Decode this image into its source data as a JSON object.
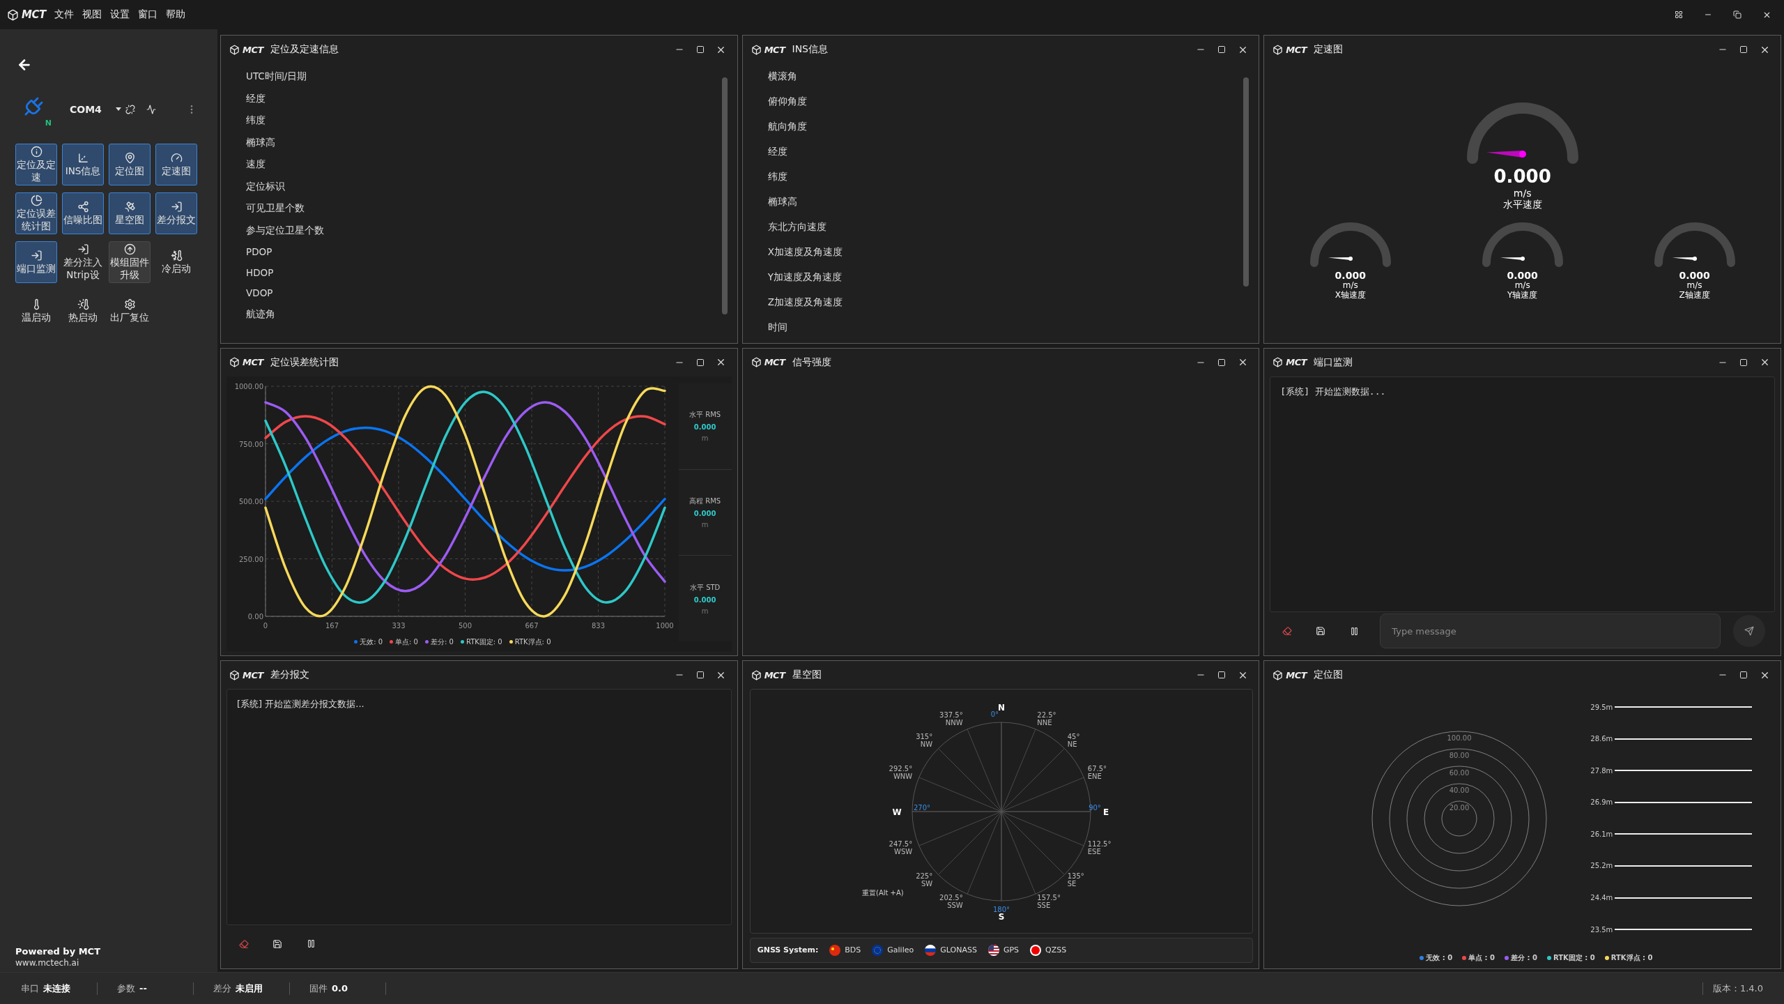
{
  "menu_bar": {
    "logo": "MCT",
    "menus": [
      "文件",
      "视图",
      "设置",
      "窗口",
      "帮助"
    ]
  },
  "sidebar": {
    "device": {
      "port": "COM4",
      "badge": "N"
    },
    "tools": [
      {
        "label": "定位及定速",
        "selected": true,
        "hovered": false
      },
      {
        "label": "INS信息",
        "selected": true,
        "hovered": false
      },
      {
        "label": "定位图",
        "selected": true,
        "hovered": false
      },
      {
        "label": "定速图",
        "selected": true,
        "hovered": false
      },
      {
        "label": "定位误差统计图",
        "selected": true,
        "hovered": false
      },
      {
        "label": "信噪比图",
        "selected": true,
        "hovered": false
      },
      {
        "label": "星空图",
        "selected": true,
        "hovered": false
      },
      {
        "label": "差分报文",
        "selected": true,
        "hovered": false
      },
      {
        "label": "端口监测",
        "selected": true,
        "hovered": false
      },
      {
        "label": "差分注入Ntrip设",
        "selected": false,
        "hovered": false
      },
      {
        "label": "模组固件升级",
        "selected": false,
        "hovered": true
      },
      {
        "label": "冷启动",
        "selected": false,
        "hovered": false
      },
      {
        "label": "温启动",
        "selected": false,
        "hovered": false
      },
      {
        "label": "热启动",
        "selected": false,
        "hovered": false
      },
      {
        "label": "出厂复位",
        "selected": false,
        "hovered": false
      }
    ],
    "footer": {
      "powered": "Powered by MCT",
      "url": "www.mctech.ai"
    }
  },
  "panels": [
    {
      "kind": "fields",
      "brand": "MCT",
      "title": "定位及定速信息",
      "fields": [
        "UTC时间/日期",
        "经度",
        "纬度",
        "椭球高",
        "速度",
        "定位标识",
        "可见卫星个数",
        "参与定位卫星个数",
        "PDOP",
        "HDOP",
        "VDOP",
        "航迹角"
      ]
    },
    {
      "kind": "fields",
      "brand": "MCT",
      "title": "INS信息",
      "fields": [
        "横滚角",
        "俯仰角度",
        "航向角度",
        "经度",
        "纬度",
        "椭球高",
        "东北方向速度",
        "X加速度及角速度",
        "Y加速度及角速度",
        "Z加速度及角速度",
        "时间"
      ]
    },
    {
      "kind": "gauges",
      "brand": "MCT",
      "title": "定速图",
      "gauges": [
        {
          "value": "0.000",
          "unit": "m/s",
          "label": "水平速度"
        },
        {
          "value": "0.000",
          "unit": "m/s",
          "label": "X轴速度"
        },
        {
          "value": "0.000",
          "unit": "m/s",
          "label": "Y轴速度"
        },
        {
          "value": "0.000",
          "unit": "m/s",
          "label": "Z轴速度"
        }
      ]
    },
    {
      "kind": "error_chart",
      "brand": "MCT",
      "title": "定位误差统计图",
      "chart_data": {
        "type": "line",
        "grid": true,
        "legend": "bottom",
        "x": [
          0,
          50,
          100,
          150,
          200,
          250,
          300,
          350,
          400,
          450,
          500,
          550,
          600,
          650,
          700,
          750,
          800,
          850,
          900,
          950,
          1000
        ],
        "xlim": [
          0,
          1000
        ],
        "ylim": [
          0,
          1000
        ],
        "xticks": [
          0,
          {
            "value": 166.7,
            "label": "167"
          },
          {
            "value": 333.3,
            "label": "333"
          },
          500,
          {
            "value": 666.7,
            "label": "667"
          },
          {
            "value": 833.3,
            "label": "833"
          },
          1000
        ],
        "yticks": [
          {
            "value": 0,
            "label": "0.00"
          },
          {
            "value": 250,
            "label": "250.00"
          },
          {
            "value": 500,
            "label": "500.00"
          },
          {
            "value": 750,
            "label": "750.00"
          },
          {
            "value": 1000,
            "label": "1000.00"
          }
        ],
        "series": [
          {
            "name": "无效: 0",
            "color": "#0a74f0",
            "values": [
              510,
              606,
              692,
              761,
              805,
              820,
              805,
              761,
              692,
              606,
              510,
              414,
              328,
              259,
              215,
              200,
              215,
              259,
              328,
              414,
              510
            ]
          },
          {
            "name": "单点: 0",
            "color": "#f0474a",
            "values": [
              775,
              845,
              870,
              845,
              775,
              669,
              542,
              411,
              293,
              208,
              164,
              169,
              222,
              315,
              436,
              568,
              693,
              793,
              854,
              869,
              835
            ]
          },
          {
            "name": "差分: 0",
            "color": "#9b5cf2",
            "values": [
              930,
              889,
              776,
              611,
              429,
              264,
              151,
              110,
              151,
              264,
              429,
              611,
              776,
              889,
              930,
              889,
              776,
              611,
              429,
              264,
              151
            ]
          },
          {
            "name": "RTK固定: 0",
            "color": "#2ec8c8",
            "values": [
              850,
              655,
              426,
              219,
              88,
              65,
              156,
              338,
              564,
              780,
              929,
              975,
              907,
              740,
              518,
              296,
              129,
              61,
              107,
              256,
              472
            ]
          },
          {
            "name": "RTK浮点: 0",
            "color": "#f7d95a",
            "values": [
              472,
              210,
              38,
              7,
              127,
              361,
              639,
              873,
              993,
              962,
              790,
              528,
              258,
              62,
              1,
              93,
              309,
              583,
              833,
              980,
              980
            ]
          }
        ]
      },
      "stats": [
        {
          "label": "水平 RMS",
          "value": "0.000",
          "unit": "m"
        },
        {
          "label": "高程 RMS",
          "value": "0.000",
          "unit": "m"
        },
        {
          "label": "水平 STD",
          "value": "0.000",
          "unit": "m"
        }
      ]
    },
    {
      "kind": "empty",
      "brand": "MCT",
      "title": "信号强度"
    },
    {
      "kind": "monitor",
      "brand": "MCT",
      "title": "端口监测",
      "log": "[系统] 开始监测数据...",
      "placeholder": "Type message"
    },
    {
      "kind": "log",
      "brand": "MCT",
      "title": "差分报文",
      "log": "[系统] 开始监测差分报文数据..."
    },
    {
      "kind": "sky",
      "brand": "MCT",
      "title": "星空图",
      "cardinals": [
        {
          "letter": "N",
          "degree": "0°"
        },
        {
          "letter": "E",
          "degree": "90°"
        },
        {
          "letter": "S",
          "degree": "180°"
        },
        {
          "letter": "W",
          "degree": "270°"
        }
      ],
      "bearings": [
        {
          "degree": "337.5°",
          "dir": "NNW"
        },
        {
          "degree": "22.5°",
          "dir": "NNE"
        },
        {
          "degree": "315°",
          "dir": "NW"
        },
        {
          "degree": "45°",
          "dir": "NE"
        },
        {
          "degree": "292.5°",
          "dir": "WNW"
        },
        {
          "degree": "67.5°",
          "dir": "ENE"
        },
        {
          "degree": "247.5°",
          "dir": "WSW"
        },
        {
          "degree": "112.5°",
          "dir": "ESE"
        },
        {
          "degree": "225°",
          "dir": "SW"
        },
        {
          "degree": "135°",
          "dir": "SE"
        },
        {
          "degree": "202.5°",
          "dir": "SSW"
        },
        {
          "degree": "157.5°",
          "dir": "SSE"
        }
      ],
      "reset_hint": "重置(Alt +A)",
      "legend_label": "GNSS System:",
      "systems": [
        "BDS",
        "Galileo",
        "GLONASS",
        "GPS",
        "QZSS"
      ]
    },
    {
      "kind": "position",
      "brand": "MCT",
      "title": "定位图",
      "rings": [
        "100.00",
        "80.00",
        "60.00",
        "40.00",
        "20.00"
      ],
      "altitudes": [
        "29.5m",
        "28.6m",
        "27.8m",
        "26.9m",
        "26.1m",
        "25.2m",
        "24.4m",
        "23.5m"
      ],
      "legend": [
        {
          "text": "无效 : 0",
          "color": "#2f7fe0"
        },
        {
          "text": "单点 : 0",
          "color": "#f0474a"
        },
        {
          "text": "差分 : 0",
          "color": "#9b5cf2"
        },
        {
          "text": "RTK固定 : 0",
          "color": "#2ec8c8"
        },
        {
          "text": "RTK浮点 : 0",
          "color": "#f7d95a"
        }
      ]
    }
  ],
  "status_bar": {
    "items": [
      {
        "label": "串口",
        "value": "未连接"
      },
      {
        "label": "参数",
        "value": "--"
      },
      {
        "label": "差分",
        "value": "未启用"
      },
      {
        "label": "固件",
        "value": "0.0"
      }
    ],
    "version": "版本：1.4.0"
  }
}
